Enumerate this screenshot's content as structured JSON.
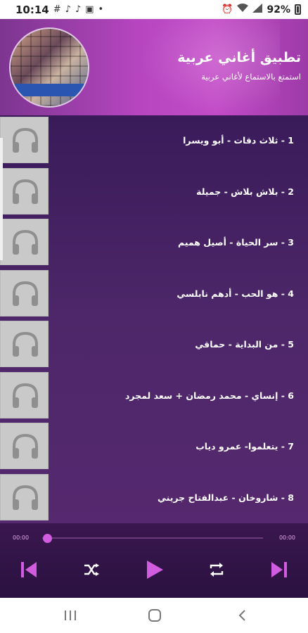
{
  "status_bar": {
    "time": "10:14",
    "battery": "92%",
    "icons": [
      "hash-icon",
      "music-note-icon",
      "music-note-icon",
      "image-icon",
      "dot-icon",
      "alarm-icon",
      "wifi-icon",
      "signal-icon",
      "battery-icon"
    ]
  },
  "header": {
    "title": "تطبيق أغاني عربية",
    "subtitle": "استمتع بالاستماع لأغاني عربية"
  },
  "songs": [
    {
      "label": "1  -  ثلاث دقات - أبو ويسرا"
    },
    {
      "label": "2  -  بلاش بلاش - جميلة"
    },
    {
      "label": "3  -  سر الحياة - أصيل هميم"
    },
    {
      "label": "4  -  هو الحب - أدهم نابلسي"
    },
    {
      "label": "5  -  من البداية - حماقي"
    },
    {
      "label": "6  -  إنساي - محمد رمضان + سعد لمجرد"
    },
    {
      "label": "7  -  يتعلموا- عمرو دياب"
    },
    {
      "label": "8  -  شاروخان - عبدالفتاح جريني"
    }
  ],
  "player": {
    "elapsed": "00:00",
    "duration": "00:00",
    "progress": 0,
    "accent": "#d25ce0"
  },
  "colors": {
    "header_accent": "#b646c0",
    "list_bg": "#4d2769",
    "player_bg": "#2a1140"
  }
}
